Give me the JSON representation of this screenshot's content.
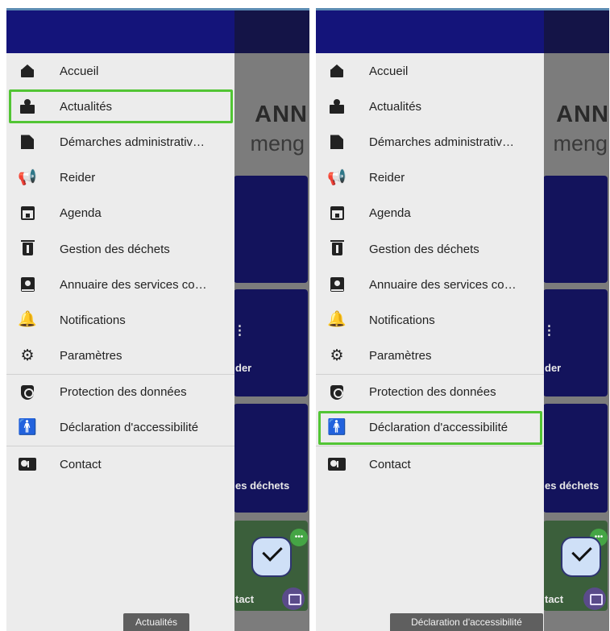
{
  "menu_items": [
    {
      "id": "accueil",
      "label": "Accueil",
      "icon": "home-icon"
    },
    {
      "id": "actualites",
      "label": "Actualités",
      "icon": "news-icon"
    },
    {
      "id": "demarches",
      "label": "Démarches administrativ…",
      "icon": "document-edit-icon"
    },
    {
      "id": "reider",
      "label": "Reider",
      "icon": "megaphone-icon"
    },
    {
      "id": "agenda",
      "label": "Agenda",
      "icon": "calendar-icon"
    },
    {
      "id": "gestion-dechets",
      "label": "Gestion des déchets",
      "icon": "trash-icon"
    },
    {
      "id": "annuaire",
      "label": "Annuaire des services co…",
      "icon": "contact-book-icon"
    },
    {
      "id": "notifications",
      "label": "Notifications",
      "icon": "bell-icon"
    },
    {
      "id": "parametres",
      "label": "Paramètres",
      "icon": "gear-icon"
    },
    {
      "id": "protection",
      "label": "Protection des données",
      "icon": "shield-icon"
    },
    {
      "id": "accessibilite",
      "label": "Déclaration d'accessibilité",
      "icon": "accessibility-icon"
    },
    {
      "id": "contact",
      "label": "Contact",
      "icon": "contact-card-icon"
    }
  ],
  "background": {
    "title_fragment": "ANN",
    "subtitle_fragment": "meng",
    "tile_labels": [
      "der",
      "es déchets"
    ],
    "bottom_fragment": "tact"
  },
  "panels": [
    {
      "highlighted": "actualites",
      "tooltip": "Actualités"
    },
    {
      "highlighted": "accessibilite",
      "tooltip": "Déclaration d'accessibilité"
    }
  ],
  "colors": {
    "drawer_header": "#14147a",
    "highlight": "#52c534",
    "tile": "#13135c"
  }
}
